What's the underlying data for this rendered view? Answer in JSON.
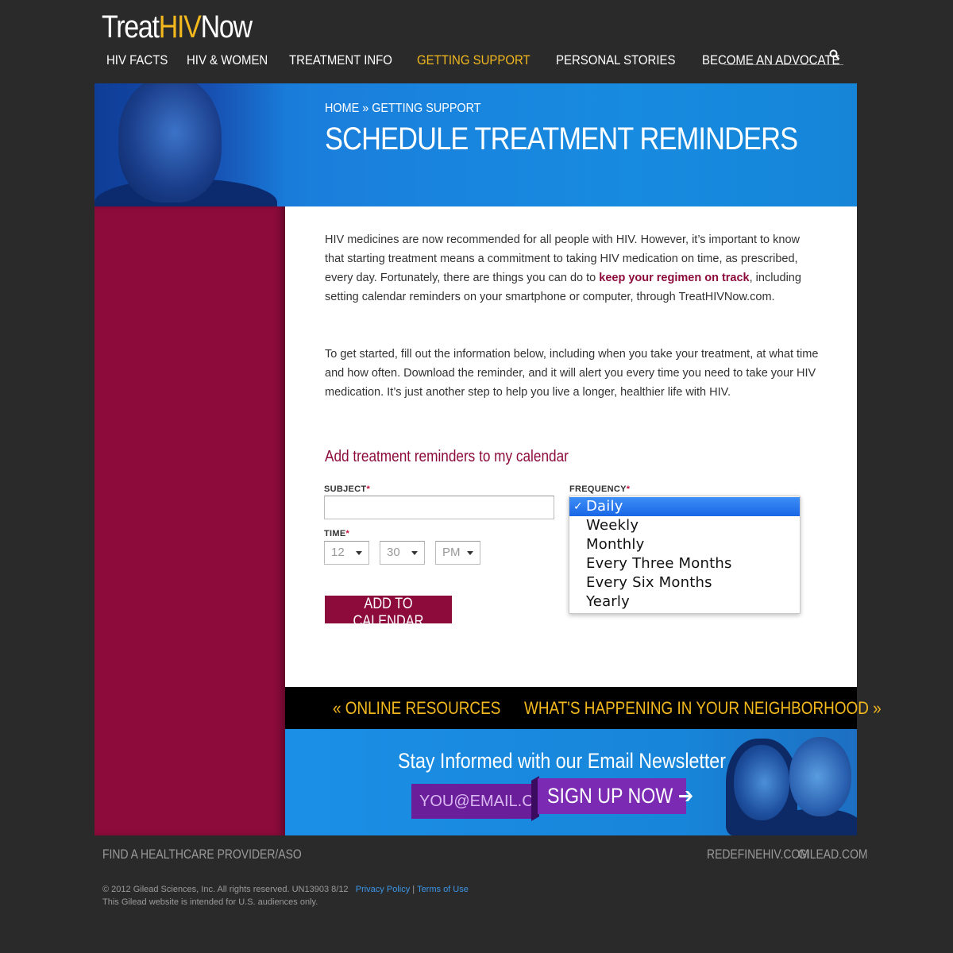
{
  "brand": {
    "treat": "Treat",
    "hiv": "HIV",
    "now": "Now"
  },
  "nav": {
    "items": [
      {
        "label": "HIV FACTS"
      },
      {
        "label": "HIV & WOMEN"
      },
      {
        "label": "TREATMENT INFO"
      },
      {
        "label": "GETTING SUPPORT",
        "active": true
      },
      {
        "label": "PERSONAL STORIES"
      },
      {
        "label": "BECOME AN ADVOCATE"
      }
    ],
    "search_icon": "search-icon"
  },
  "hero": {
    "breadcrumb": "HOME » GETTING SUPPORT",
    "title": "SCHEDULE TREATMENT REMINDERS"
  },
  "content": {
    "p1_before": "HIV medicines are now recommended for all people with HIV. However, it’s important to know that starting treatment means a commitment to taking HIV medication on time, as prescribed, every day. Fortunately, there are things you can do to ",
    "p1_link": "keep your regimen on track",
    "p1_after": ", including setting calendar reminders on your smartphone or computer, through TreatHIVNow.com.",
    "p2": "To get started, fill out the information below, including when you take your treatment, at what time and how often. Download the reminder, and it will alert you every time you need to take your HIV medication. It’s just another step to help you live a longer, healthier life with HIV."
  },
  "form": {
    "heading": "Add treatment reminders to my calendar",
    "subject_label": "SUBJECT",
    "time_label": "TIME",
    "frequency_label": "FREQUENCY",
    "required_mark": "*",
    "subject_value": "",
    "hour": "12",
    "minute": "30",
    "ampm": "PM",
    "submit": "ADD TO CALENDAR",
    "frequency_options": [
      "Daily",
      "Weekly",
      "Monthly",
      "Every Three Months",
      "Every Six Months",
      "Yearly"
    ],
    "frequency_selected": "Daily",
    "check_mark": "✓"
  },
  "strip": {
    "prev": "« ONLINE RESOURCES",
    "next": "WHAT'S HAPPENING IN YOUR NEIGHBORHOOD »"
  },
  "newsletter": {
    "title": "Stay Informed with our Email Newsletter",
    "email_placeholder": "YOU@EMAIL.COM",
    "button": "SIGN UP NOW ➔"
  },
  "footer": {
    "provider_link": "FIND A HEALTHCARE PROVIDER/ASO",
    "link_redefine": "REDEFINEHIV.COM",
    "link_gilead": "GILEAD.COM",
    "copyright": "© 2012 Gilead Sciences, Inc. All rights reserved. UN13903 8/12",
    "privacy": "Privacy Policy",
    "separator": "|",
    "terms": "Terms of Use",
    "audience": "This Gilead website is intended for U.S. audiences only."
  },
  "colors": {
    "background": "#2a2a2a",
    "accent_gold": "#f2b81e",
    "maroon": "#8c0b3b",
    "hero_blue": "#1a7fdc",
    "purple": "#7b2bb3"
  }
}
